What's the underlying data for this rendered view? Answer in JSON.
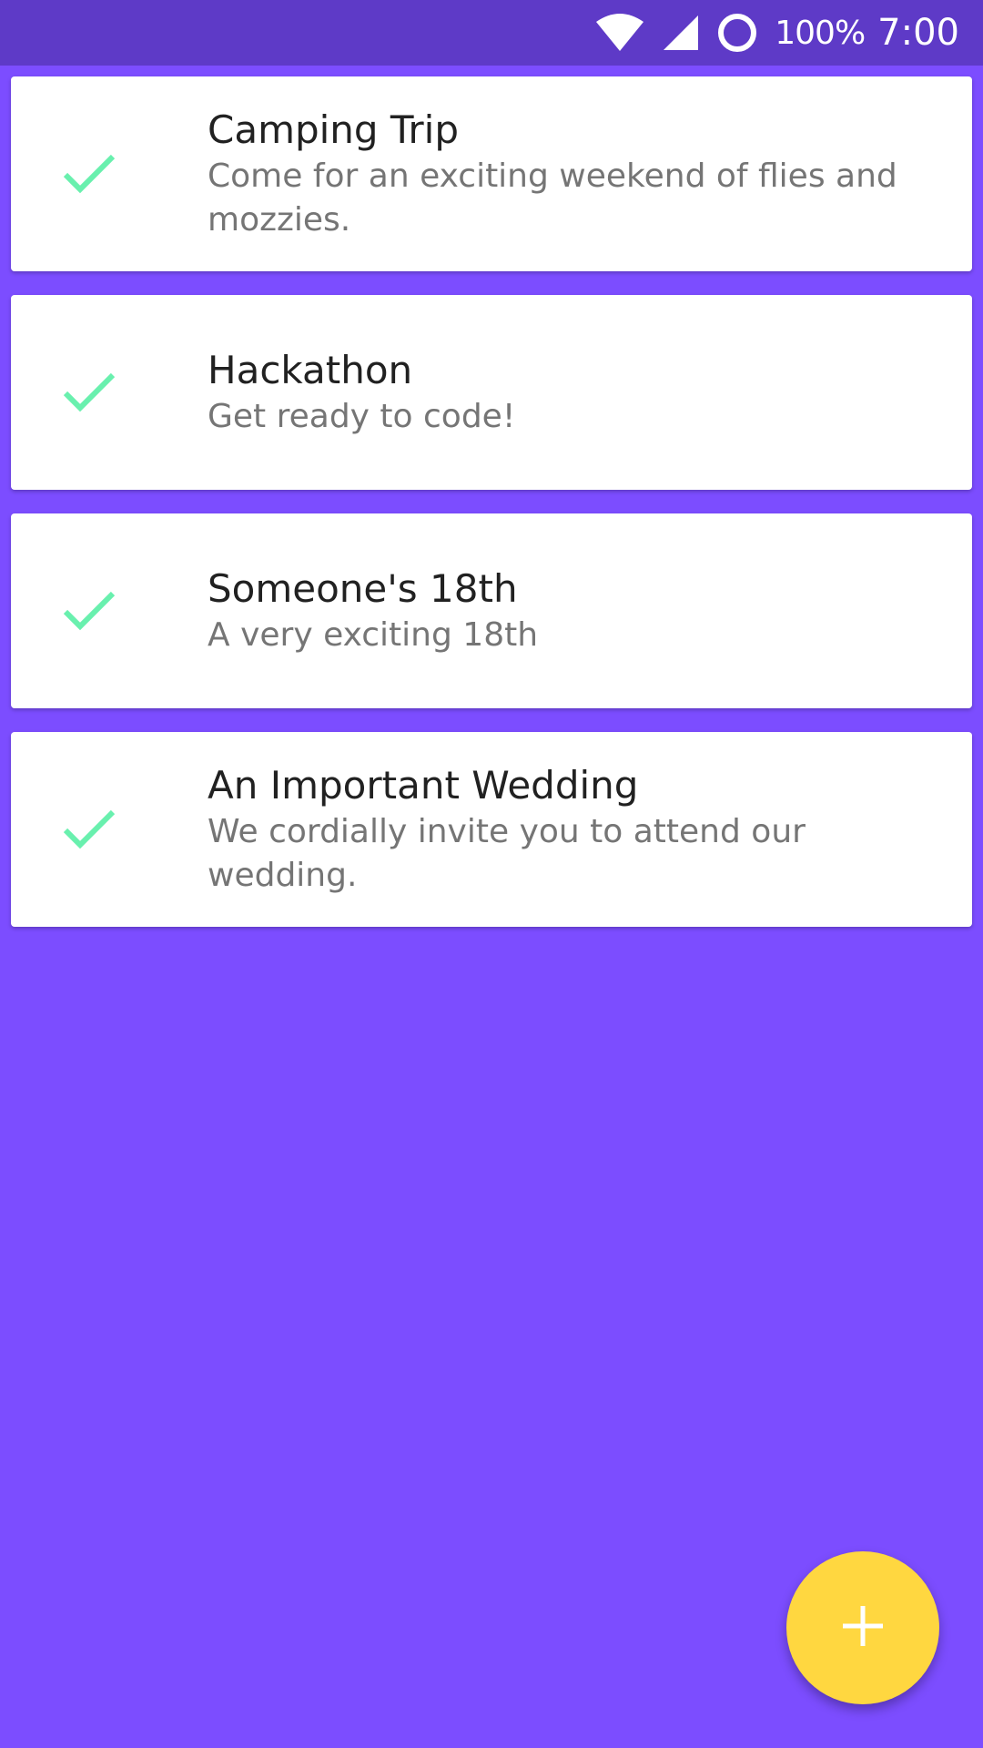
{
  "status_bar": {
    "battery_percent": "100%",
    "time": "7:00",
    "icons": [
      "wifi-icon",
      "signal-icon",
      "battery-icon"
    ]
  },
  "colors": {
    "background": "#7C4DFF",
    "status_bar": "#5E3AC7",
    "check": "#69F0AE",
    "fab": "#FFD740",
    "card": "#FFFFFF"
  },
  "events": [
    {
      "title": "Camping Trip",
      "description": "Come for an exciting weekend of flies and mozzies.",
      "icon": "check-icon"
    },
    {
      "title": "Hackathon",
      "description": "Get ready to code!",
      "icon": "check-icon"
    },
    {
      "title": "Someone's 18th",
      "description": "A very exciting 18th",
      "icon": "check-icon"
    },
    {
      "title": "An Important Wedding",
      "description": "We cordially invite you to attend our wedding.",
      "icon": "check-icon"
    }
  ],
  "fab": {
    "icon": "plus-icon"
  }
}
